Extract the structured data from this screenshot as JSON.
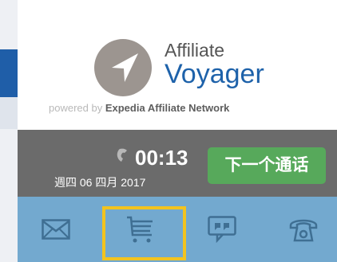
{
  "branding": {
    "name_top": "Affiliate",
    "name_main": "Voyager",
    "powered_by": "powered by",
    "network": "Expedia Affiliate Network",
    "logo_bg": "#9c9590",
    "accent": "#1e62aa"
  },
  "call": {
    "timer": "00:13",
    "date": "週四 06 四月 2017",
    "next_call_label": "下一个通话",
    "phone_icon": "phone-handset-icon"
  },
  "toolbar": {
    "items": [
      {
        "icon": "mail-icon"
      },
      {
        "icon": "cart-icon",
        "selected": true
      },
      {
        "icon": "chat-icon"
      },
      {
        "icon": "phone-icon"
      }
    ],
    "bg": "#73a9cf",
    "highlight": "#f2c31f"
  }
}
